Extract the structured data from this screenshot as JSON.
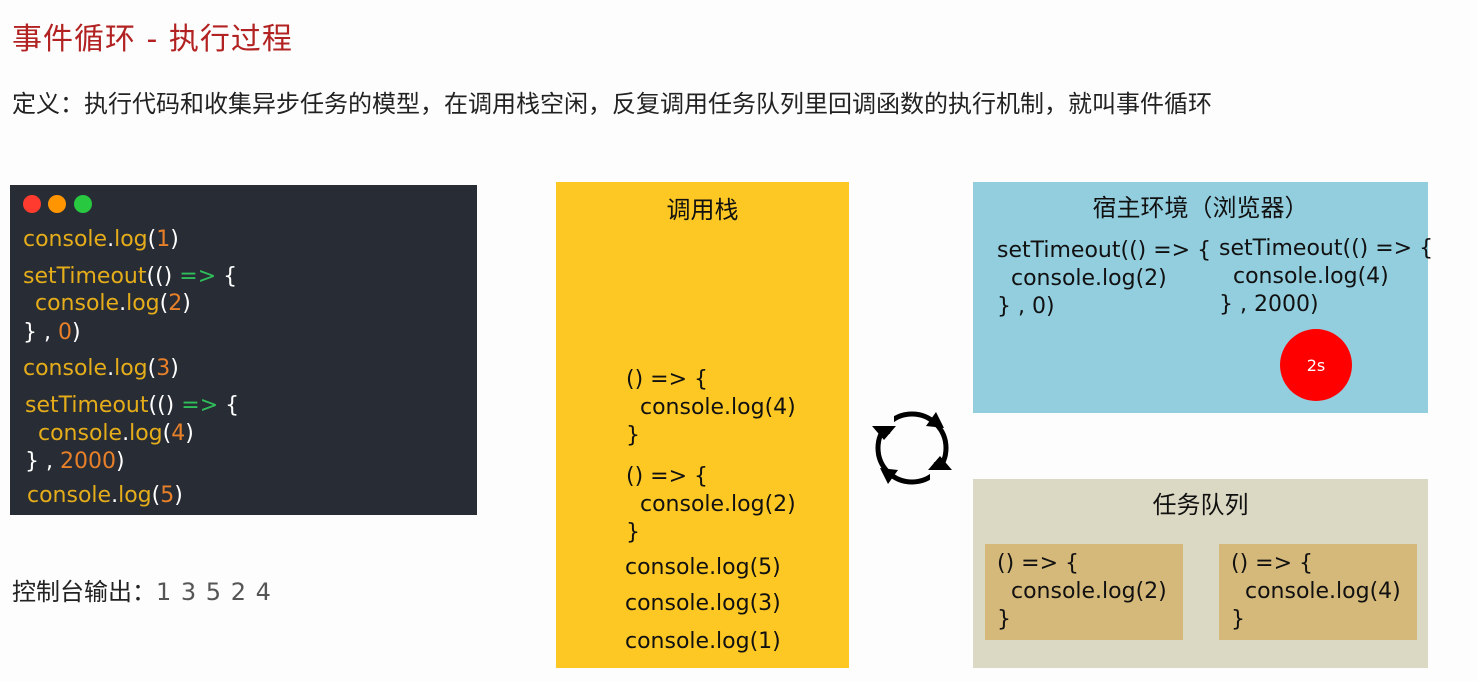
{
  "title": "事件循环 - 执行过程",
  "definition": "定义：执行代码和收集异步任务的模型，在调用栈空闲，反复调用任务队列里回调函数的执行机制，就叫事件循环",
  "code_window": {
    "dot_colors": [
      "#ff3b30",
      "#ff9500",
      "#28c840"
    ],
    "code": {
      "console": "console",
      "dot": ".",
      "log": "log",
      "paren_open": "(",
      "paren_close": ")",
      "setTimeout": "setTimeout",
      "arrow_parens": "()",
      "arrow": "=>",
      "brace_open": "{",
      "brace_close_comma": "} ,",
      "n1": "1",
      "n2": "2",
      "n3": "3",
      "n4": "4",
      "n5": "5",
      "n0": "0",
      "n2000": "2000"
    }
  },
  "console_output": {
    "label": "控制台输出：",
    "values": "1   3   5   2   4"
  },
  "call_stack": {
    "title": "调用栈",
    "items": [
      "() => {\n  console.log(4)\n}",
      "() => {\n  console.log(2)\n}",
      "console.log(5)",
      "console.log(3)",
      "console.log(1)"
    ]
  },
  "host_env": {
    "title": "宿主环境（浏览器）",
    "timers": [
      "setTimeout(() => {\n  console.log(2)\n} , 0)",
      "setTimeout(() => {\n  console.log(4)\n} , 2000)"
    ],
    "badge": "2s",
    "badge_color": "#ff0000"
  },
  "task_queue": {
    "title": "任务队列",
    "tasks": [
      "() => {\n  console.log(2)\n}",
      "() => {\n  console.log(4)\n}"
    ]
  },
  "colors": {
    "title": "#b22222",
    "code_bg": "#282c34",
    "call_stack_bg": "#fec824",
    "host_env_bg": "#93cedf",
    "task_queue_bg": "#dbd8c3",
    "task_card_bg": "#d5b97a"
  }
}
